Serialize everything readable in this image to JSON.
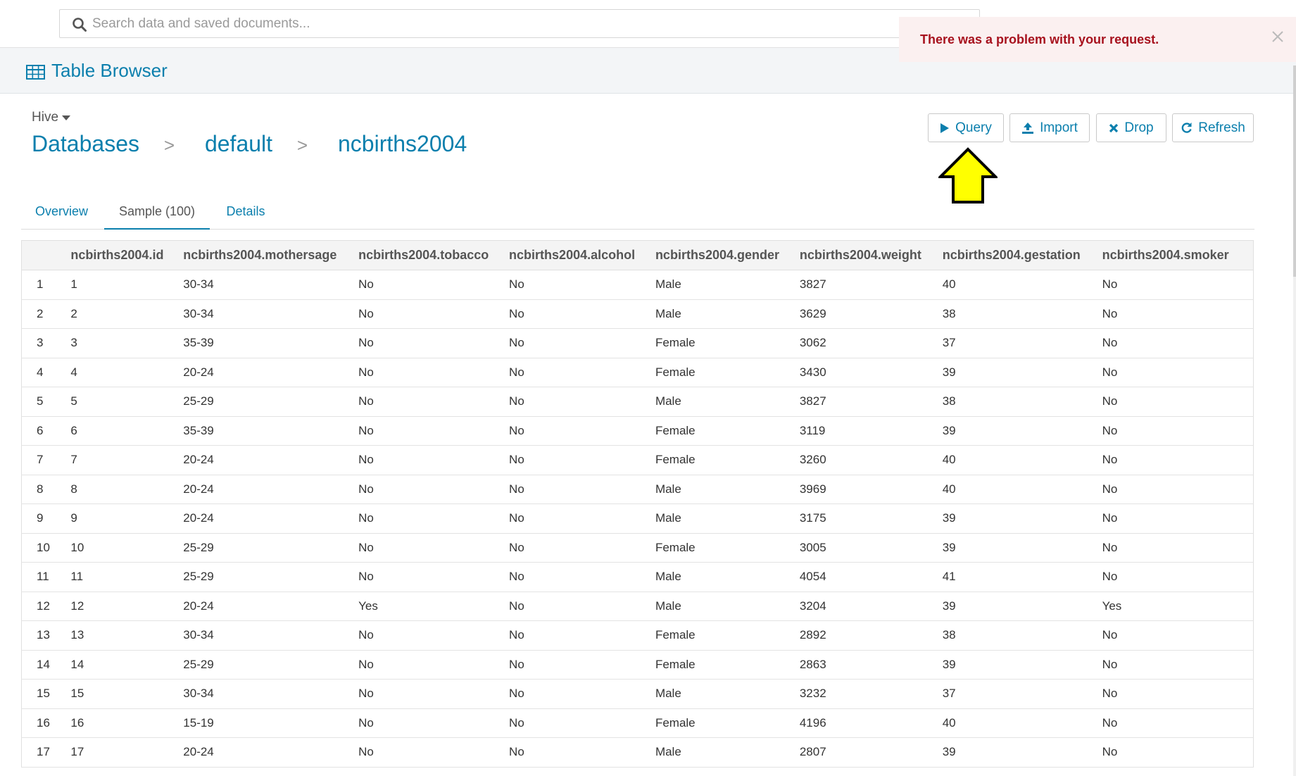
{
  "search": {
    "placeholder": "Search data and saved documents..."
  },
  "toast": {
    "message": "There was a problem with your request."
  },
  "app": {
    "title": "Table Browser"
  },
  "breadcrumb": {
    "engine": "Hive",
    "items": [
      "Databases",
      "default",
      "ncbirths2004"
    ],
    "separator": ">"
  },
  "actions": {
    "query": "Query",
    "import": "Import",
    "drop": "Drop",
    "refresh": "Refresh"
  },
  "tabs": [
    {
      "label": "Overview",
      "active": false
    },
    {
      "label": "Sample (100)",
      "active": true
    },
    {
      "label": "Details",
      "active": false
    }
  ],
  "table": {
    "columns": [
      "",
      "ncbirths2004.id",
      "ncbirths2004.mothersage",
      "ncbirths2004.tobacco",
      "ncbirths2004.alcohol",
      "ncbirths2004.gender",
      "ncbirths2004.weight",
      "ncbirths2004.gestation",
      "ncbirths2004.smoker"
    ],
    "rows": [
      [
        "1",
        "1",
        "30-34",
        "No",
        "No",
        "Male",
        "3827",
        "40",
        "No"
      ],
      [
        "2",
        "2",
        "30-34",
        "No",
        "No",
        "Male",
        "3629",
        "38",
        "No"
      ],
      [
        "3",
        "3",
        "35-39",
        "No",
        "No",
        "Female",
        "3062",
        "37",
        "No"
      ],
      [
        "4",
        "4",
        "20-24",
        "No",
        "No",
        "Female",
        "3430",
        "39",
        "No"
      ],
      [
        "5",
        "5",
        "25-29",
        "No",
        "No",
        "Male",
        "3827",
        "38",
        "No"
      ],
      [
        "6",
        "6",
        "35-39",
        "No",
        "No",
        "Female",
        "3119",
        "39",
        "No"
      ],
      [
        "7",
        "7",
        "20-24",
        "No",
        "No",
        "Female",
        "3260",
        "40",
        "No"
      ],
      [
        "8",
        "8",
        "20-24",
        "No",
        "No",
        "Male",
        "3969",
        "40",
        "No"
      ],
      [
        "9",
        "9",
        "20-24",
        "No",
        "No",
        "Male",
        "3175",
        "39",
        "No"
      ],
      [
        "10",
        "10",
        "25-29",
        "No",
        "No",
        "Female",
        "3005",
        "39",
        "No"
      ],
      [
        "11",
        "11",
        "25-29",
        "No",
        "No",
        "Male",
        "4054",
        "41",
        "No"
      ],
      [
        "12",
        "12",
        "20-24",
        "Yes",
        "No",
        "Male",
        "3204",
        "39",
        "Yes"
      ],
      [
        "13",
        "13",
        "30-34",
        "No",
        "No",
        "Female",
        "2892",
        "38",
        "No"
      ],
      [
        "14",
        "14",
        "25-29",
        "No",
        "No",
        "Female",
        "2863",
        "39",
        "No"
      ],
      [
        "15",
        "15",
        "30-34",
        "No",
        "No",
        "Male",
        "3232",
        "37",
        "No"
      ],
      [
        "16",
        "16",
        "15-19",
        "No",
        "No",
        "Female",
        "4196",
        "40",
        "No"
      ],
      [
        "17",
        "17",
        "20-24",
        "No",
        "No",
        "Male",
        "2807",
        "39",
        "No"
      ]
    ]
  },
  "colors": {
    "accent": "#0b7fad",
    "error_text": "#a7121e",
    "error_bg": "#fbf0f0",
    "arrow_fill": "#ffff00"
  }
}
